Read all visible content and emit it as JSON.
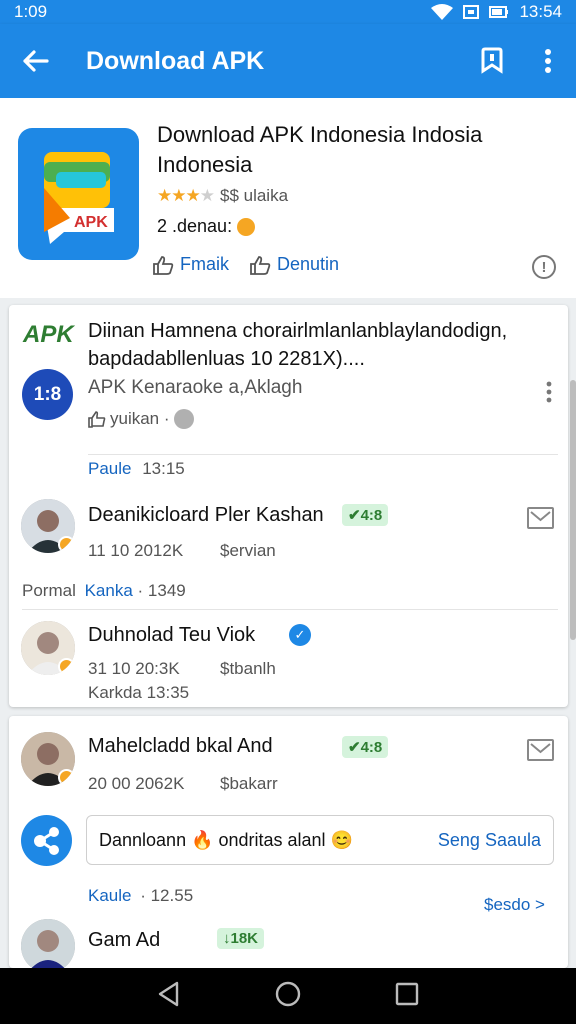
{
  "status_bar": {
    "time": "1:09",
    "clock": "13:54"
  },
  "app_bar": {
    "title": "Download APK"
  },
  "app": {
    "title": "Download APK Indonesia Indosia Indonesia",
    "rating_text": "$$ ulaika",
    "downloads": "2 .denau:",
    "logo_text": "APK",
    "actions": {
      "like": "Fmaik",
      "download": "Denutin"
    }
  },
  "card1": {
    "brand": "APK",
    "headline": "Diinan Hamnena chorairlmlanlanblaylandodign, bapdadabllenluas 10 2281X)....",
    "post_avatar_text": "1:8",
    "post_subtitle": "APK Kenaraoke a,Aklagh",
    "post_meta": "yuikan ·",
    "section1": {
      "label": "Paule",
      "time": "13:15"
    },
    "user1": {
      "name": "Deanikicloard Pler Kashan",
      "tag": "4:8",
      "stats": "11 10 2012K",
      "status": "$ervian"
    },
    "section2": {
      "label": "Pormal",
      "link": "Kanka",
      "time": "· 1349"
    },
    "user2": {
      "name": "Duhnolad Teu Viok",
      "stats": "31 10 20:3K",
      "status": "$tbanlh",
      "footer": "Karkda 13:35"
    }
  },
  "card2": {
    "user3": {
      "name": "Mahelcladd bkal And",
      "tag": "4:8",
      "stats": "20 00 2062K",
      "status": "$bakarr"
    },
    "comment_box": {
      "text": "Dannloann 🔥 ondritas alanl 😊",
      "link": "Seng Saaula"
    },
    "section": {
      "label": "Kaule",
      "time": "· 12.55",
      "link": "$esdo >"
    },
    "user4": {
      "name": "Gam Ad",
      "tag": "18K"
    }
  },
  "colors": {
    "primary": "#1e88e5",
    "link": "#1565c0",
    "tag_green": "#2e7d32",
    "star": "#f5a623"
  }
}
